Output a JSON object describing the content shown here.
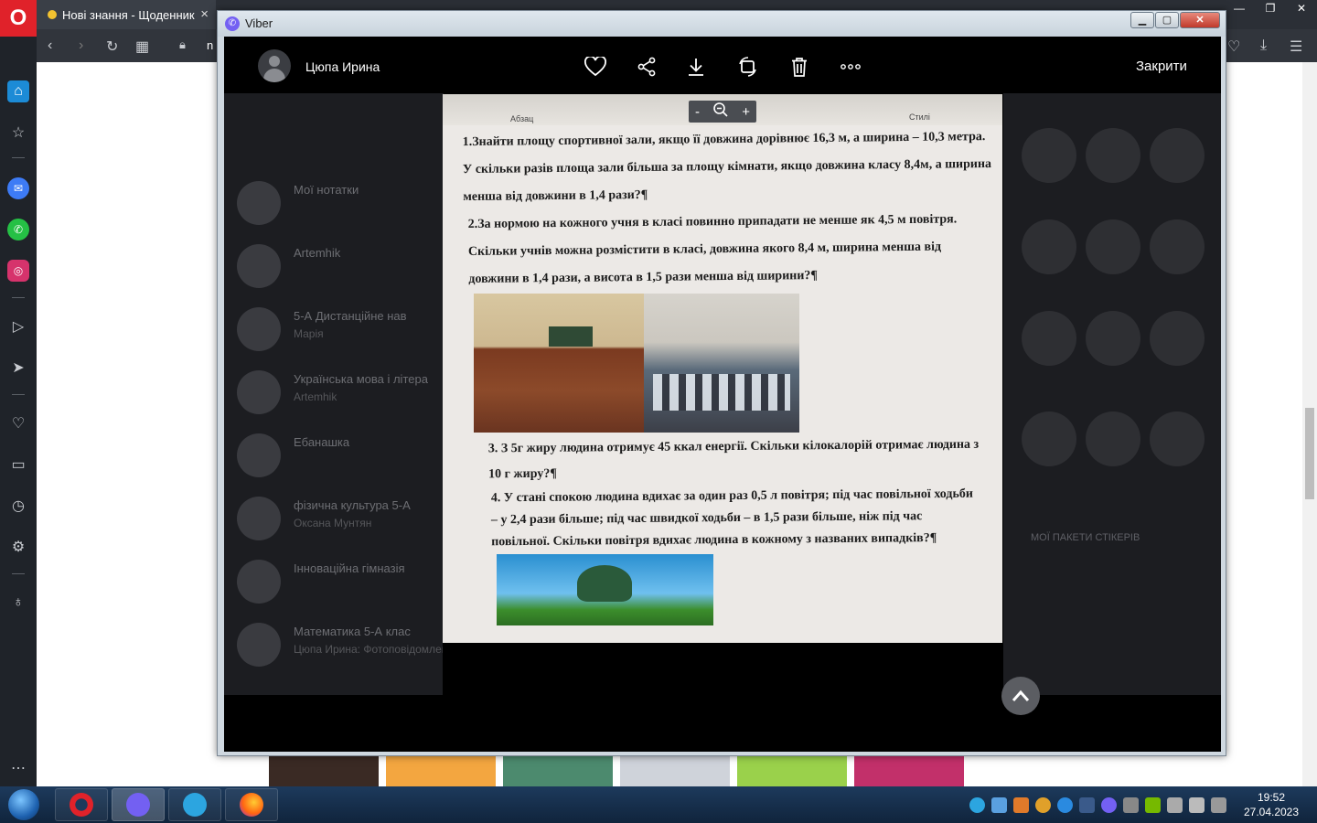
{
  "browser": {
    "tab_title": "Нові знання - Щоденник",
    "url_fragment": "n"
  },
  "viber": {
    "window_title": "Viber",
    "sender_name": "Цюпа Ирина",
    "close_label": "Закрити",
    "zoom": {
      "minus": "-",
      "plus": "+"
    },
    "background_chats": [
      {
        "title": "Мої нотатки",
        "preview": ""
      },
      {
        "title": "Artemhik",
        "preview": ""
      },
      {
        "title": "5-А Дистанційне нав",
        "preview": "Марія"
      },
      {
        "title": "Українська мова і літера",
        "preview": "Artemhik"
      },
      {
        "title": "Ебанашка",
        "preview": ""
      },
      {
        "title": "фізична культура 5-А",
        "preview": "Оксана Мунтян"
      },
      {
        "title": "Інноваційна гімназія",
        "preview": ""
      },
      {
        "title": "Математика 5-А клас",
        "preview": "Цюпа Ирина: Фотоповідомлення"
      }
    ],
    "stickers_label": "МОЇ ПАКЕТИ СТІКЕРІВ",
    "photo": {
      "toolbar_abzac": "Абзац",
      "toolbar_styles": "Стилі",
      "task1": "1.Знайти площу спортивної зали, якщо її довжина дорівнює 16,3 м, а ширина – 10,3 метра. У скільки разів площа зали більша за площу кімнати, якщо довжина класу 8,4м, а ширина менша від довжини в 1,4 рази?¶",
      "task2": "2.За нормою на кожного учня в класі повинно припадати не менше як 4,5 м повітря. Скільки учнів можна розмістити в класі, довжина якого 8,4 м, ширина менша від довжини в 1,4 рази, а висота в 1,5 рази менша від ширини?¶",
      "task3": "3. З 5г жиру людина отримує 45 ккал енергії. Скільки кілокалорій отримає людина з 10 г жиру?¶",
      "task4": "4. У стані спокою людина вдихає за один раз 0,5 л повітря; під час повільної ходьби – у 2,4 рази більше; під час швидкої ходьби – в 1,5 рази більше, ніж під час повільної. Скільки повітря вдихає людина в кожному з названих випадків?¶"
    }
  },
  "taskbar": {
    "time": "19:52",
    "date": "27.04.2023"
  },
  "colors": {
    "opera_red": "#e0222a",
    "viber_purple": "#7360f2",
    "viewer_bg": "#000000"
  }
}
